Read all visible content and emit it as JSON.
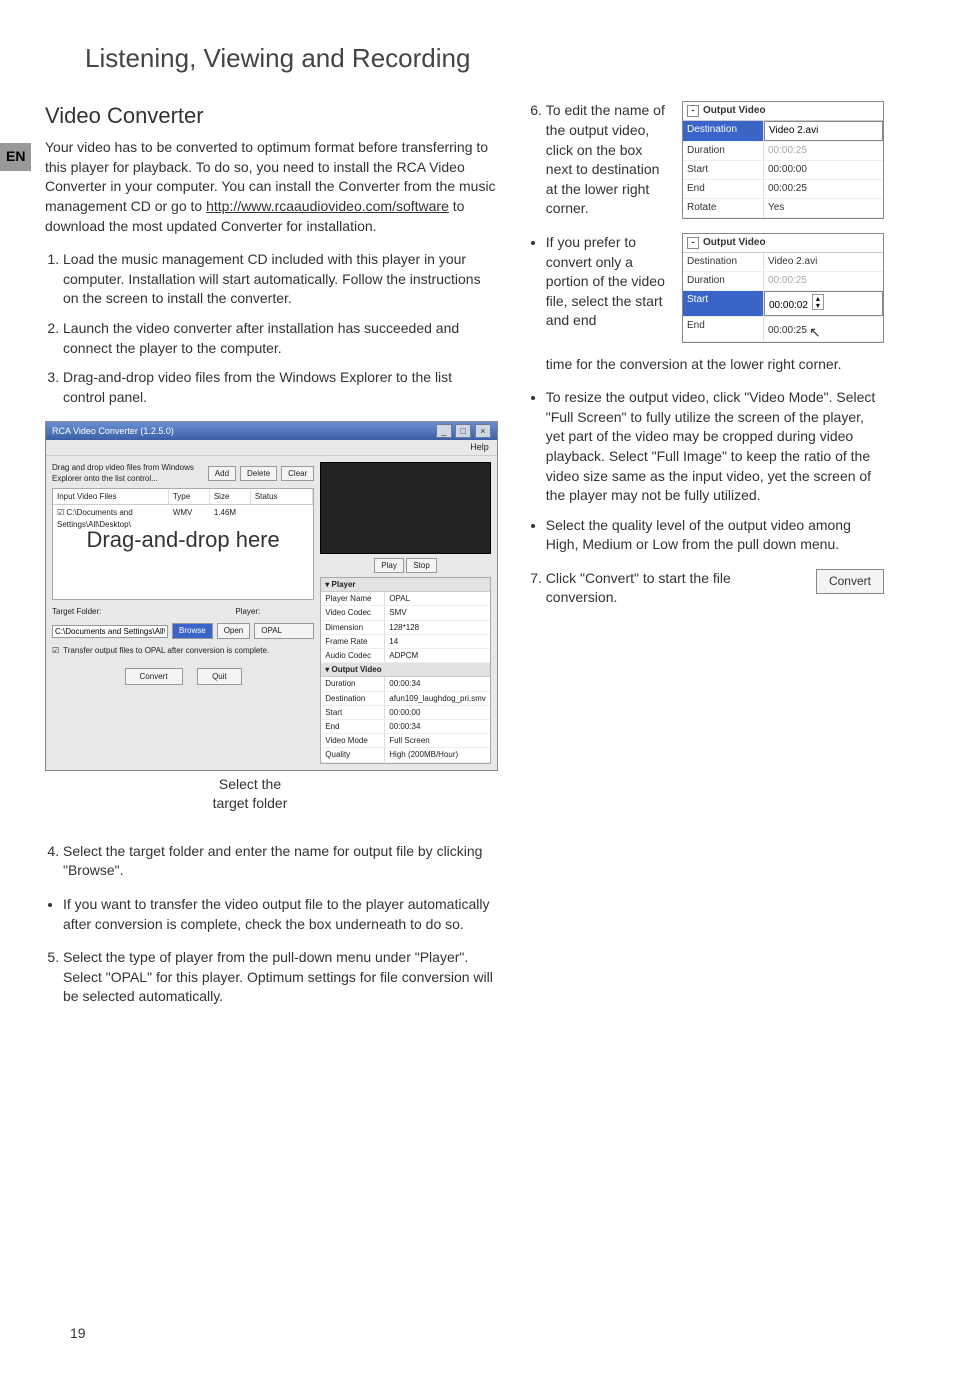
{
  "page_number": "19",
  "lang_tab": "EN",
  "section_title": "Listening, Viewing and Recording",
  "sub_title": "Video Converter",
  "intro": "Your video has to be converted to optimum format before transferring to this player for playback. To do so, you need to install the RCA Video Converter in your computer. You can install the Converter from the music management CD or go to ",
  "intro_link": "http://www.rcaaudiovideo.com/software",
  "intro_tail": " to download the most updated Converter for installation.",
  "left_list": {
    "1": "Load the music management CD included with this player in your computer. Installation will start automatically. Follow the instructions on the screen to install the converter.",
    "2": "Launch the video converter after installation has succeeded and connect the player to the computer.",
    "3": "Drag-and-drop video files from the Windows Explorer to the list control panel."
  },
  "app": {
    "title": "RCA Video Converter (1.2.5.0)",
    "win_min": "_",
    "win_max": "□",
    "win_close": "×",
    "help": "Help",
    "drag_label": "Drag and drop video files from Windows Explorer onto the list control...",
    "btn_add": "Add",
    "btn_delete": "Delete",
    "btn_clear": "Clear",
    "col_input": "Input Video Files",
    "col_type": "Type",
    "col_size": "Size",
    "col_status": "Status",
    "row_path": "C:\\Documents and Settings\\All\\Desktop\\",
    "row_type": "WMV",
    "row_size": "1.46M",
    "drag_overlay": "Drag-and-drop here",
    "target_folder_label": "Target Folder:",
    "player_label": "Player:",
    "tf_value": "C:\\Documents and Settings\\All\\My D",
    "btn_browse": "Browse",
    "btn_open": "Open",
    "player_value": "OPAL",
    "cb_label": "Transfer output files to OPAL after conversion is complete.",
    "btn_convert": "Convert",
    "btn_quit": "Quit",
    "btn_play": "Play",
    "btn_stop": "Stop",
    "grp_player": "Player",
    "pname_k": "Player Name",
    "pname_v": "OPAL",
    "vcodec_k": "Video Codec",
    "vcodec_v": "SMV",
    "dim_k": "Dimension",
    "dim_v": "128*128",
    "fr_k": "Frame Rate",
    "fr_v": "14",
    "acodec_k": "Audio Codec",
    "acodec_v": "ADPCM",
    "grp_out": "Output Video",
    "dur_k": "Duration",
    "dur_v": "00:00:34",
    "dest_k": "Destination",
    "dest_v": "afun109_laughdog_pri.smv",
    "st_k": "Start",
    "st_v": "00:00:00",
    "en_k": "End",
    "en_v": "00:00:34",
    "vm_k": "Video Mode",
    "vm_v": "Full Screen",
    "q_k": "Quality",
    "q_v": "High (200MB/Hour)"
  },
  "caption": "Select the\ntarget folder",
  "left_list2": {
    "4": "Select the target folder and enter the name for output file by clicking \"Browse\".",
    "b1": "If you want to transfer the video output file to the player automatically after conversion is complete, check the box underneath to do so.",
    "5": "Select the type of player from the pull-down menu under \"Player\". Select \"OPAL\" for this player. Optimum settings for file conversion will be selected automatically."
  },
  "right": {
    "6": "To edit the name of the output video, click on the box next to destination at the lower right corner.",
    "b1_head": "If you prefer to convert only a portion of the video file, select the start and end",
    "b1_tail": " time for the conversion at the lower right corner.",
    "b2": "To resize the output video, click \"Video Mode\". Select \"Full Screen\" to fully utilize the screen of the player, yet part of the video may be cropped during video playback. Select \"Full Image\" to keep the ratio of the video size same as the input video, yet the screen of the player may not be fully utilized.",
    "b3": "Select the quality level of the output video among High, Medium or Low from the pull down menu.",
    "7": "Click \"Convert\" to start the file conversion."
  },
  "mini1": {
    "title": "Output Video",
    "dest_k": "Destination",
    "dest_v": "Video 2.avi",
    "dur_k": "Duration",
    "dur_v": "00:00:25",
    "st_k": "Start",
    "st_v": "00:00:00",
    "en_k": "End",
    "en_v": "00:00:25",
    "rot_k": "Rotate",
    "rot_v": "Yes"
  },
  "mini2": {
    "title": "Output Video",
    "dest_k": "Destination",
    "dest_v": "Video 2.avi",
    "dur_k": "Duration",
    "dur_v": "00:00:25",
    "st_k": "Start",
    "st_v": "00:00:02",
    "en_k": "End",
    "en_v": "00:00:25"
  },
  "convert_btn": "Convert"
}
